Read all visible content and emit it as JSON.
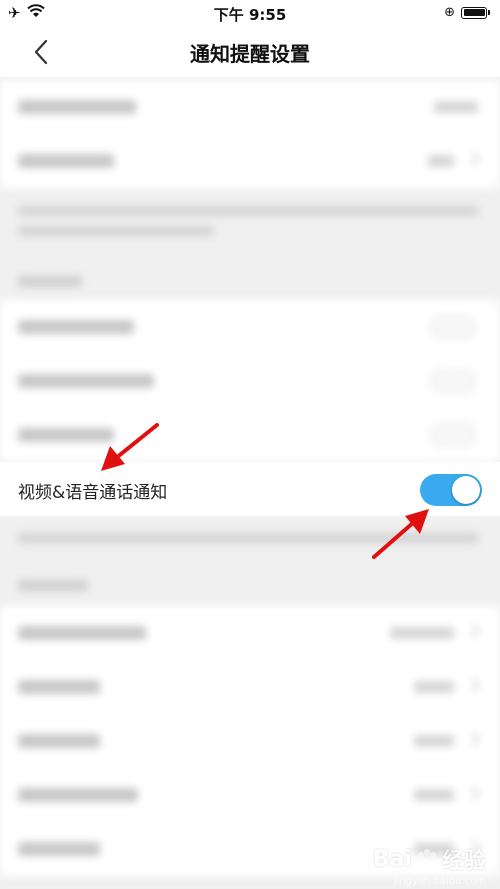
{
  "status_bar": {
    "time": "下午 9:55",
    "left_icons": [
      "airplane-icon",
      "wifi-icon"
    ],
    "right_icons": [
      "rotation-lock-icon",
      "battery-icon"
    ]
  },
  "nav": {
    "title": "通知提醒设置"
  },
  "focus_setting": {
    "label": "视频&语音通话通知",
    "enabled": true
  },
  "watermark": {
    "text": "Bai",
    "text_end": "经验",
    "sub": "jingyan.baidu.com"
  },
  "colors": {
    "toggle_on": "#3aaaf0",
    "annotation_arrow": "#e01010"
  }
}
